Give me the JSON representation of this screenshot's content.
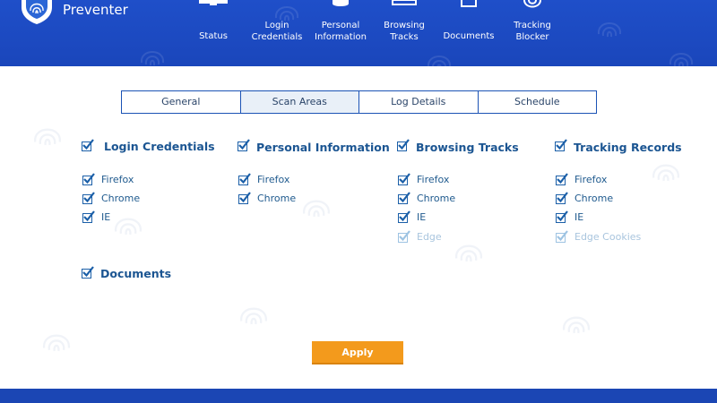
{
  "app": {
    "name": "Preventer"
  },
  "nav": [
    {
      "key": "status",
      "label": "Status",
      "icon": "monitor-icon"
    },
    {
      "key": "login",
      "label": "Login\nCredentials",
      "icon": "key-icon"
    },
    {
      "key": "personal",
      "label": "Personal\nInformation",
      "icon": "database-icon"
    },
    {
      "key": "browsing",
      "label": "Browsing\nTracks",
      "icon": "browser-icon"
    },
    {
      "key": "documents",
      "label": "Documents",
      "icon": "document-icon"
    },
    {
      "key": "tracking",
      "label": "Tracking\nBlocker",
      "icon": "target-icon"
    }
  ],
  "tabs": [
    {
      "label": "General",
      "active": false
    },
    {
      "label": "Scan Areas",
      "active": true
    },
    {
      "label": "Log Details",
      "active": false
    },
    {
      "label": "Schedule",
      "active": false
    }
  ],
  "sections": {
    "login": {
      "title": "Login Credentials",
      "checked": true,
      "items": [
        {
          "label": "Firefox",
          "checked": true,
          "disabled": false
        },
        {
          "label": "Chrome",
          "checked": true,
          "disabled": false
        },
        {
          "label": "IE",
          "checked": true,
          "disabled": false
        }
      ]
    },
    "personal": {
      "title": "Personal Information",
      "checked": true,
      "items": [
        {
          "label": "Firefox",
          "checked": true,
          "disabled": false
        },
        {
          "label": "Chrome",
          "checked": true,
          "disabled": false
        }
      ]
    },
    "browsing": {
      "title": "Browsing Tracks",
      "checked": true,
      "items": [
        {
          "label": "Firefox",
          "checked": true,
          "disabled": false
        },
        {
          "label": "Chrome",
          "checked": true,
          "disabled": false
        },
        {
          "label": "IE",
          "checked": true,
          "disabled": false
        },
        {
          "label": "Edge",
          "checked": true,
          "disabled": true
        }
      ]
    },
    "tracking": {
      "title": "Tracking Records",
      "checked": true,
      "items": [
        {
          "label": "Firefox",
          "checked": true,
          "disabled": false
        },
        {
          "label": "Chrome",
          "checked": true,
          "disabled": false
        },
        {
          "label": "IE",
          "checked": true,
          "disabled": false
        },
        {
          "label": "Edge Cookies",
          "checked": true,
          "disabled": true
        }
      ]
    },
    "documents": {
      "title": "Documents",
      "checked": true,
      "items": []
    }
  },
  "apply_label": "Apply",
  "colors": {
    "header": "#1f4fc9",
    "accent": "#1b5592",
    "apply": "#f39a1c",
    "disabled": "#a9c5de"
  }
}
